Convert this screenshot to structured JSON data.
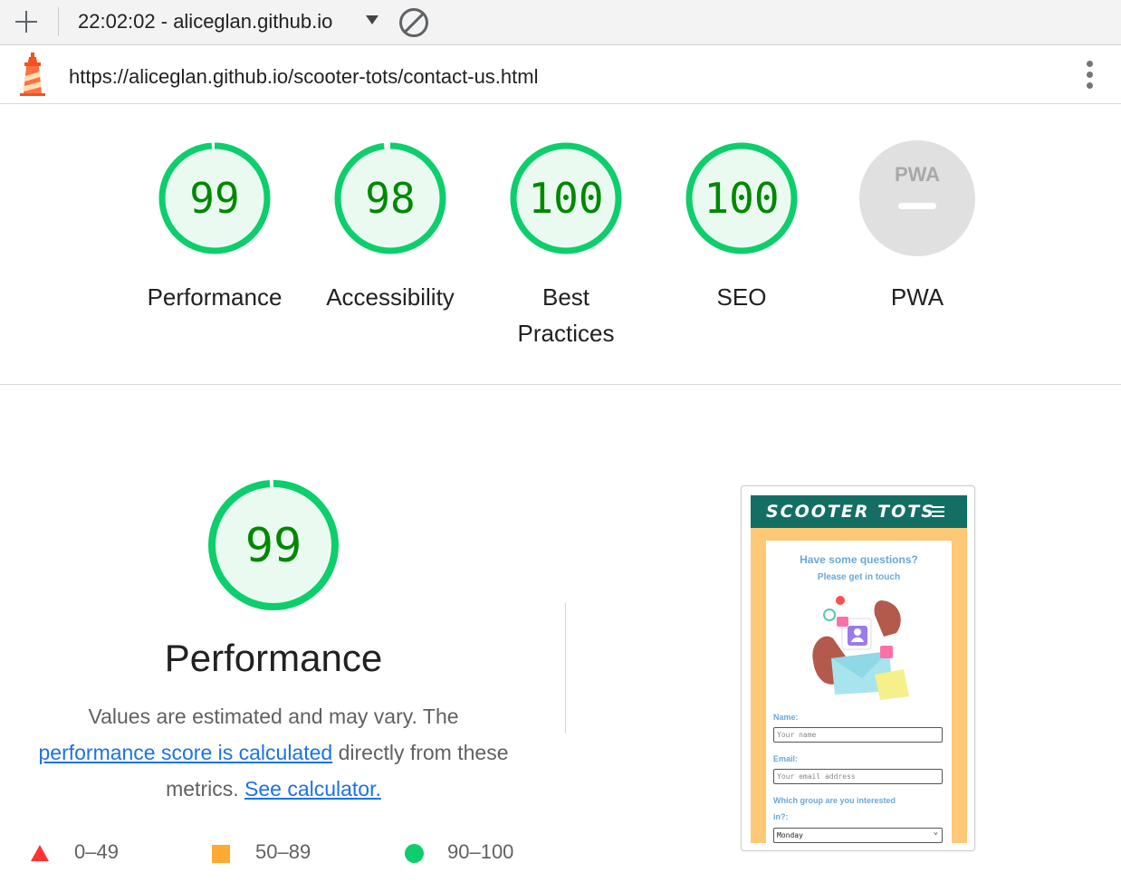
{
  "toolbar": {
    "session": "22:02:02 - aliceglan.github.io"
  },
  "urlbar": {
    "url": "https://aliceglan.github.io/scooter-tots/contact-us.html"
  },
  "gauges": [
    {
      "label": "Performance",
      "score": "99",
      "value": 99
    },
    {
      "label": "Accessibility",
      "score": "98",
      "value": 98
    },
    {
      "label": "Best Practices",
      "score": "100",
      "value": 100
    },
    {
      "label": "SEO",
      "score": "100",
      "value": 100
    },
    {
      "label": "PWA",
      "badge": "PWA"
    }
  ],
  "performance": {
    "score": "99",
    "value": 99,
    "title": "Performance",
    "desc_1": "Values are estimated and may vary. The",
    "link_1": "performance score is calculated",
    "desc_2": " directly from these metrics.",
    "link_2": "See calculator."
  },
  "legend": [
    {
      "range": "0–49",
      "color": "#ff3333",
      "icon": "triangle-icon"
    },
    {
      "range": "50–89",
      "color": "#ffaa33",
      "icon": "square-icon"
    },
    {
      "range": "90–100",
      "color": "#0cce6b",
      "icon": "circle-icon"
    }
  ],
  "thumbnail": {
    "brand": "SCOOTER TOTS",
    "heading": "Have some questions?",
    "subheading": "Please get in touch",
    "name_label": "Name:",
    "name_placeholder": "Your name",
    "email_label": "Email:",
    "email_placeholder": "Your email address",
    "group_label_1": "Which group are you interested",
    "group_label_2": "in?:",
    "group_value": "Monday"
  },
  "colors": {
    "pass": "#0cce6b",
    "pass_text": "#008800",
    "pass_fill": "#eafaf1",
    "link": "#1a73e8",
    "thumb_nav": "#136f63",
    "thumb_bg": "#ffc876"
  }
}
